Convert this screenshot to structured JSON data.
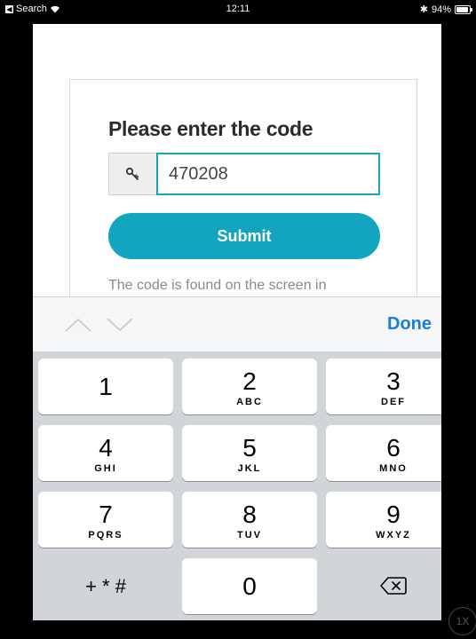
{
  "status_bar": {
    "back_label": "Search",
    "time": "12:11",
    "battery": "94%"
  },
  "form": {
    "title": "Please enter the code",
    "code_value": "470208",
    "submit_label": "Submit",
    "hint": "The code is found on the screen in"
  },
  "accessory": {
    "done_label": "Done"
  },
  "keypad": {
    "k1": {
      "num": "1",
      "letters": ""
    },
    "k2": {
      "num": "2",
      "letters": "ABC"
    },
    "k3": {
      "num": "3",
      "letters": "DEF"
    },
    "k4": {
      "num": "4",
      "letters": "GHI"
    },
    "k5": {
      "num": "5",
      "letters": "JKL"
    },
    "k6": {
      "num": "6",
      "letters": "MNO"
    },
    "k7": {
      "num": "7",
      "letters": "PQRS"
    },
    "k8": {
      "num": "8",
      "letters": "TUV"
    },
    "k9": {
      "num": "9",
      "letters": "WXYZ"
    },
    "k0": {
      "num": "0"
    },
    "symbols": "+ * #"
  },
  "corner_badge": "1X",
  "colors": {
    "accent": "#13a4bf",
    "done": "#1a7ddb",
    "keyboard_bg": "#d1d4d9"
  }
}
